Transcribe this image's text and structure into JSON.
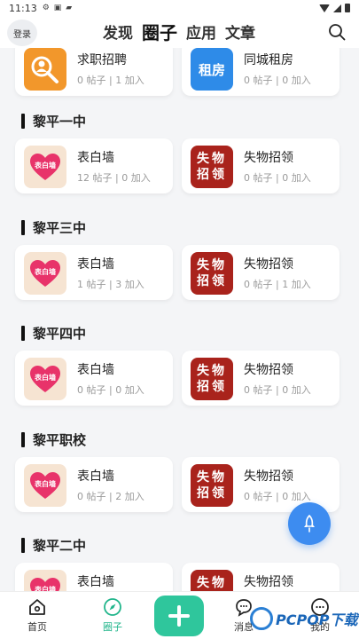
{
  "status_bar": {
    "time": "11:13"
  },
  "header": {
    "login": "登录",
    "tabs": [
      {
        "label": "发现",
        "active": false
      },
      {
        "label": "圈子",
        "active": true
      },
      {
        "label": "应用",
        "active": false
      },
      {
        "label": "文章",
        "active": false
      }
    ]
  },
  "top_cards": [
    {
      "title": "求职招聘",
      "stats": "0 帖子 | 1 加入",
      "icon": "job-search-icon"
    },
    {
      "title": "同城租房",
      "stats": "0 帖子 | 0 加入",
      "icon": "rent-icon",
      "icon_text": "租房"
    }
  ],
  "sections": [
    {
      "name": "黎平一中",
      "cards": [
        {
          "title": "表白墙",
          "stats": "12 帖子 | 0 加入"
        },
        {
          "title": "失物招领",
          "stats": "0 帖子 | 0 加入"
        }
      ]
    },
    {
      "name": "黎平三中",
      "cards": [
        {
          "title": "表白墙",
          "stats": "1 帖子 | 3 加入"
        },
        {
          "title": "失物招领",
          "stats": "0 帖子 | 1 加入"
        }
      ]
    },
    {
      "name": "黎平四中",
      "cards": [
        {
          "title": "表白墙",
          "stats": "0 帖子 | 0 加入"
        },
        {
          "title": "失物招领",
          "stats": "0 帖子 | 0 加入"
        }
      ]
    },
    {
      "name": "黎平职校",
      "cards": [
        {
          "title": "表白墙",
          "stats": "0 帖子 | 2 加入"
        },
        {
          "title": "失物招领",
          "stats": "0 帖子 | 0 加入"
        }
      ]
    },
    {
      "name": "黎平二中",
      "cards": [
        {
          "title": "表白墙",
          "stats": ""
        },
        {
          "title": "失物招领",
          "stats": ""
        }
      ]
    }
  ],
  "icon_labels": {
    "wall": "表白墙",
    "lost": "失物\n招领"
  },
  "bottom_nav": [
    {
      "label": "首页",
      "icon": "home-icon",
      "active": false
    },
    {
      "label": "圈子",
      "icon": "compass-icon",
      "active": true
    },
    {
      "label": "消息",
      "icon": "chat-icon",
      "active": false
    },
    {
      "label": "我的",
      "icon": "profile-icon",
      "active": false
    }
  ],
  "watermark": {
    "text": "PCPOP下载"
  },
  "colors": {
    "accent": "#2fc69c",
    "fab": "#3d8cf0",
    "lost_red": "#a9231c",
    "rent_blue": "#2e8be8",
    "job_orange": "#f2972b"
  }
}
